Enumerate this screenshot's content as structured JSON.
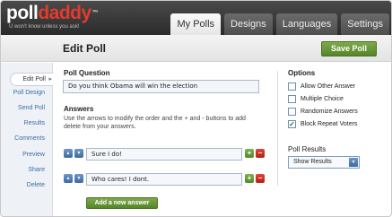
{
  "brand": {
    "logo_part1": "poll",
    "logo_part2": "daddy",
    "logo_mark": "™",
    "tagline": "U won't know unless you ask!"
  },
  "nav": {
    "tabs": [
      {
        "label": "My Polls",
        "active": true
      },
      {
        "label": "Designs",
        "active": false
      },
      {
        "label": "Languages",
        "active": false
      },
      {
        "label": "Settings",
        "active": false
      }
    ]
  },
  "titlebar": {
    "title": "Edit Poll",
    "save_label": "Save Poll"
  },
  "sidebar": {
    "items": [
      {
        "label": "Edit Poll",
        "active": true
      },
      {
        "label": "Poll Design"
      },
      {
        "label": "Send Poll"
      },
      {
        "label": "Results"
      },
      {
        "label": "Comments"
      },
      {
        "label": "Preview"
      },
      {
        "label": "Share"
      },
      {
        "label": "Delete"
      }
    ]
  },
  "question": {
    "label": "Poll Question",
    "value": "Do you think Obama will win the election"
  },
  "answers": {
    "label": "Answers",
    "help": "Use the arrows to modify the order and the + and - buttons to add delete from your answers.",
    "items": [
      {
        "value": "Sure I do!"
      },
      {
        "value": "Who cares! I dont."
      }
    ],
    "add_label": "Add a new answer"
  },
  "options": {
    "label": "Options",
    "items": [
      {
        "label": "Allow Other Answer",
        "checked": false
      },
      {
        "label": "Multiple Choice",
        "checked": false
      },
      {
        "label": "Randomize Answers",
        "checked": false
      },
      {
        "label": "Block Repeat Voters",
        "checked": true
      }
    ]
  },
  "results": {
    "label": "Poll Results",
    "selected": "Show Results"
  },
  "icons": {
    "up": "arrow-up-icon",
    "down": "arrow-down-icon",
    "add": "plus-icon",
    "remove": "minus-icon",
    "check": "checkmark-icon",
    "dropdown": "chevron-down-icon"
  },
  "colors": {
    "header_bg": "#2b2b2b",
    "logo_accent": "#e53a2e",
    "button_green": "#55852a",
    "link_blue": "#3b6aa8",
    "remove_red": "#b32018"
  }
}
